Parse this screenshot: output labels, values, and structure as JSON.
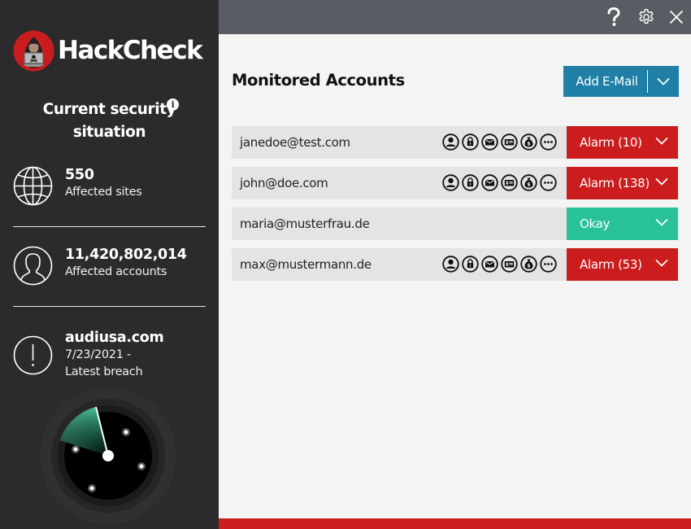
{
  "app": {
    "name": "HackCheck",
    "brand_color": "#cb1d1d"
  },
  "topbar": {
    "help_icon": "question-mark",
    "settings_icon": "gear",
    "close_icon": "close-x"
  },
  "sidebar": {
    "situation_title": "Current security situation",
    "situation_line1": "Current security",
    "situation_line2": "situation",
    "info_icon_glyph": "i",
    "stats": [
      {
        "icon": "globe",
        "value": "550",
        "label": "Affected sites"
      },
      {
        "icon": "user",
        "value": "11,420,802,014",
        "label": "Affected accounts"
      },
      {
        "icon": "exclamation",
        "value": "audiusa.com",
        "label_line1": "7/23/2021 -",
        "label_line2": "Latest breach"
      }
    ],
    "radar": {
      "icon": "radar-scanner"
    }
  },
  "main": {
    "title": "Monitored Accounts",
    "add_button": {
      "label": "Add E-Mail",
      "color": "#1f7fa6"
    },
    "category_icons": [
      "personal-data",
      "password",
      "email",
      "id-card",
      "financial",
      "more"
    ],
    "accounts": [
      {
        "email": "janedoe@test.com",
        "status": "alarm",
        "status_label": "Alarm (10)",
        "alarm_count": 10,
        "show_icons": true
      },
      {
        "email": "john@doe.com",
        "status": "alarm",
        "status_label": "Alarm (138)",
        "alarm_count": 138,
        "show_icons": true
      },
      {
        "email": "maria@musterfrau.de",
        "status": "okay",
        "status_label": "Okay",
        "alarm_count": 0,
        "show_icons": false
      },
      {
        "email": "max@mustermann.de",
        "status": "alarm",
        "status_label": "Alarm (53)",
        "alarm_count": 53,
        "show_icons": true
      }
    ],
    "status_colors": {
      "alarm": "#cb1d1d",
      "okay": "#29c198"
    }
  }
}
